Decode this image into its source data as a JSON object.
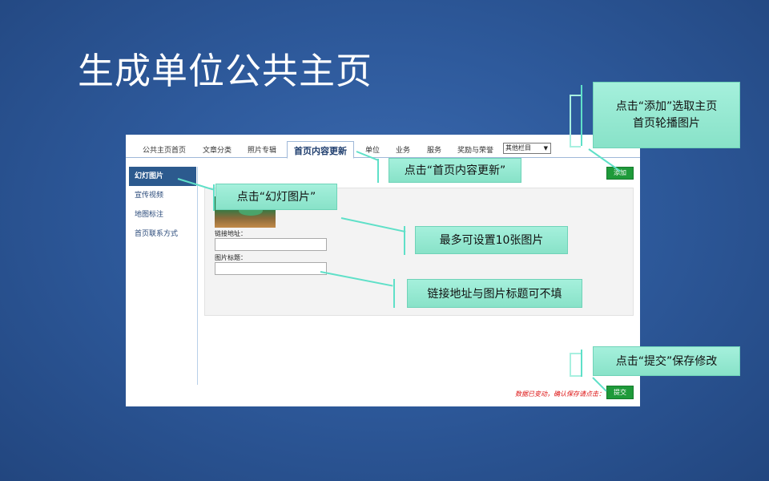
{
  "slide": {
    "title": "生成单位公共主页"
  },
  "tabs": [
    "公共主页首页",
    "文章分类",
    "照片专辑",
    "首页内容更新",
    "单位",
    "业务",
    "服务",
    "奖励与荣誉"
  ],
  "select": {
    "value": "其他栏目",
    "arrow": "▼"
  },
  "sidebar": {
    "items": [
      "幻灯图片",
      "宣传视频",
      "地图标注",
      "首页联系方式"
    ]
  },
  "form": {
    "link_label": "链接地址：",
    "title_label": "图片标题：",
    "link_value": "",
    "title_value": ""
  },
  "buttons": {
    "add": "添加",
    "submit": "提交"
  },
  "warning": "数据已变动，确认保存请点击：",
  "callouts": {
    "add": "点击“添加”选取主页首页轮播图片",
    "add_line1": "点击“添加”选取主页",
    "add_line2": "首页轮播图片",
    "update_tab": "点击“首页内容更新”",
    "slide_image": "点击“幻灯图片”",
    "max_images": "最多可设置10张图片",
    "optional_fields": "链接地址与图片标题可不填",
    "submit": "点击“提交”保存修改"
  },
  "colors": {
    "accent_green": "#1e9a3a",
    "callout": "#8fe8d0",
    "active_side": "#2c5a8e"
  }
}
